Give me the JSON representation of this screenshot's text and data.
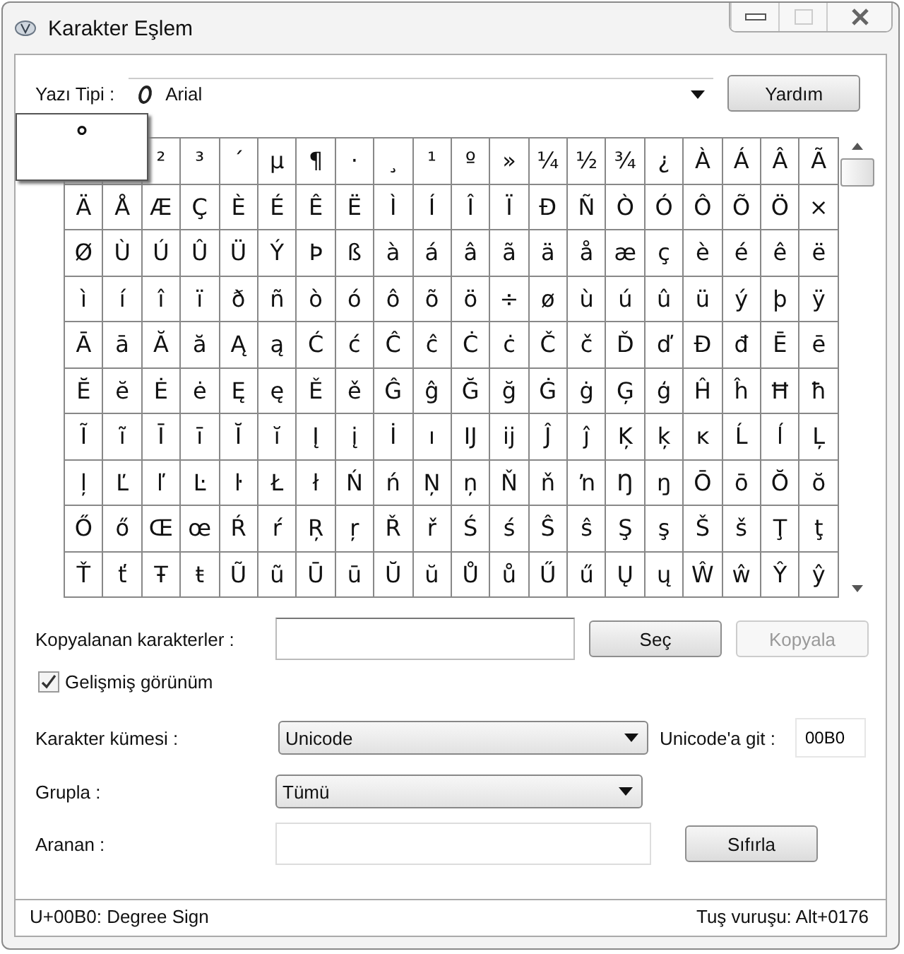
{
  "window": {
    "title": "Karakter Eşlem"
  },
  "font": {
    "label": "Yazı Tipi :",
    "value": "Arial"
  },
  "help_button": "Yardım",
  "magnified": "°",
  "grid": [
    [
      "²",
      "³",
      "´",
      "µ",
      "¶",
      "·",
      "¸",
      "¹",
      "º",
      "»",
      "¼",
      "½",
      "¾",
      "¿",
      "À",
      "Á",
      "Â",
      "Ã"
    ],
    [
      "Ä",
      "Å",
      "Æ",
      "Ç",
      "È",
      "É",
      "Ê",
      "Ë",
      "Ì",
      "Í",
      "Î",
      "Ï",
      "Ð",
      "Ñ",
      "Ò",
      "Ó",
      "Ô",
      "Õ",
      "Ö",
      "×"
    ],
    [
      "Ø",
      "Ù",
      "Ú",
      "Û",
      "Ü",
      "Ý",
      "Þ",
      "ß",
      "à",
      "á",
      "â",
      "ã",
      "ä",
      "å",
      "æ",
      "ç",
      "è",
      "é",
      "ê",
      "ë"
    ],
    [
      "ì",
      "í",
      "î",
      "ï",
      "ð",
      "ñ",
      "ò",
      "ó",
      "ô",
      "õ",
      "ö",
      "÷",
      "ø",
      "ù",
      "ú",
      "û",
      "ü",
      "ý",
      "þ",
      "ÿ"
    ],
    [
      "Ā",
      "ā",
      "Ă",
      "ă",
      "Ą",
      "ą",
      "Ć",
      "ć",
      "Ĉ",
      "ĉ",
      "Ċ",
      "ċ",
      "Č",
      "č",
      "Ď",
      "ď",
      "Đ",
      "đ",
      "Ē",
      "ē"
    ],
    [
      "Ĕ",
      "ĕ",
      "Ė",
      "ė",
      "Ę",
      "ę",
      "Ě",
      "ě",
      "Ĝ",
      "ĝ",
      "Ğ",
      "ğ",
      "Ġ",
      "ġ",
      "Ģ",
      "ģ",
      "Ĥ",
      "ĥ",
      "Ħ",
      "ħ"
    ],
    [
      "Ĩ",
      "ĩ",
      "Ī",
      "ī",
      "Ĭ",
      "ĭ",
      "Į",
      "į",
      "İ",
      "ı",
      "Ĳ",
      "ĳ",
      "Ĵ",
      "ĵ",
      "Ķ",
      "ķ",
      "ĸ",
      "Ĺ",
      "ĺ",
      "Ļ"
    ],
    [
      "ļ",
      "Ľ",
      "ľ",
      "Ŀ",
      "ŀ",
      "Ł",
      "ł",
      "Ń",
      "ń",
      "Ņ",
      "ņ",
      "Ň",
      "ň",
      "ŉ",
      "Ŋ",
      "ŋ",
      "Ō",
      "ō",
      "Ŏ",
      "ŏ"
    ],
    [
      "Ő",
      "ő",
      "Œ",
      "œ",
      "Ŕ",
      "ŕ",
      "Ŗ",
      "ŗ",
      "Ř",
      "ř",
      "Ś",
      "ś",
      "Ŝ",
      "ŝ",
      "Ş",
      "ş",
      "Š",
      "š",
      "Ţ",
      "ţ"
    ],
    [
      "Ť",
      "ť",
      "Ŧ",
      "ŧ",
      "Ũ",
      "ũ",
      "Ū",
      "ū",
      "Ŭ",
      "ŭ",
      "Ů",
      "ů",
      "Ű",
      "ű",
      "Ų",
      "ų",
      "Ŵ",
      "ŵ",
      "Ŷ",
      "ŷ"
    ]
  ],
  "copy": {
    "label": "Kopyalanan karakterler :",
    "select_button": "Seç",
    "copy_button": {
      "label": "Kopyala",
      "disabled": true
    }
  },
  "advanced_view": {
    "label": "Gelişmiş görünüm",
    "checked": true
  },
  "charset": {
    "label": "Karakter kümesi :",
    "value": "Unicode"
  },
  "goto_unicode": {
    "label": "Unicode'a git :",
    "value": "00B0"
  },
  "group": {
    "label": "Grupla :",
    "value": "Tümü"
  },
  "search": {
    "label": "Aranan :",
    "reset_button": "Sıfırla"
  },
  "status_bar": {
    "left": "U+00B0: Degree Sign",
    "right": "Tuş vuruşu: Alt+0176"
  }
}
